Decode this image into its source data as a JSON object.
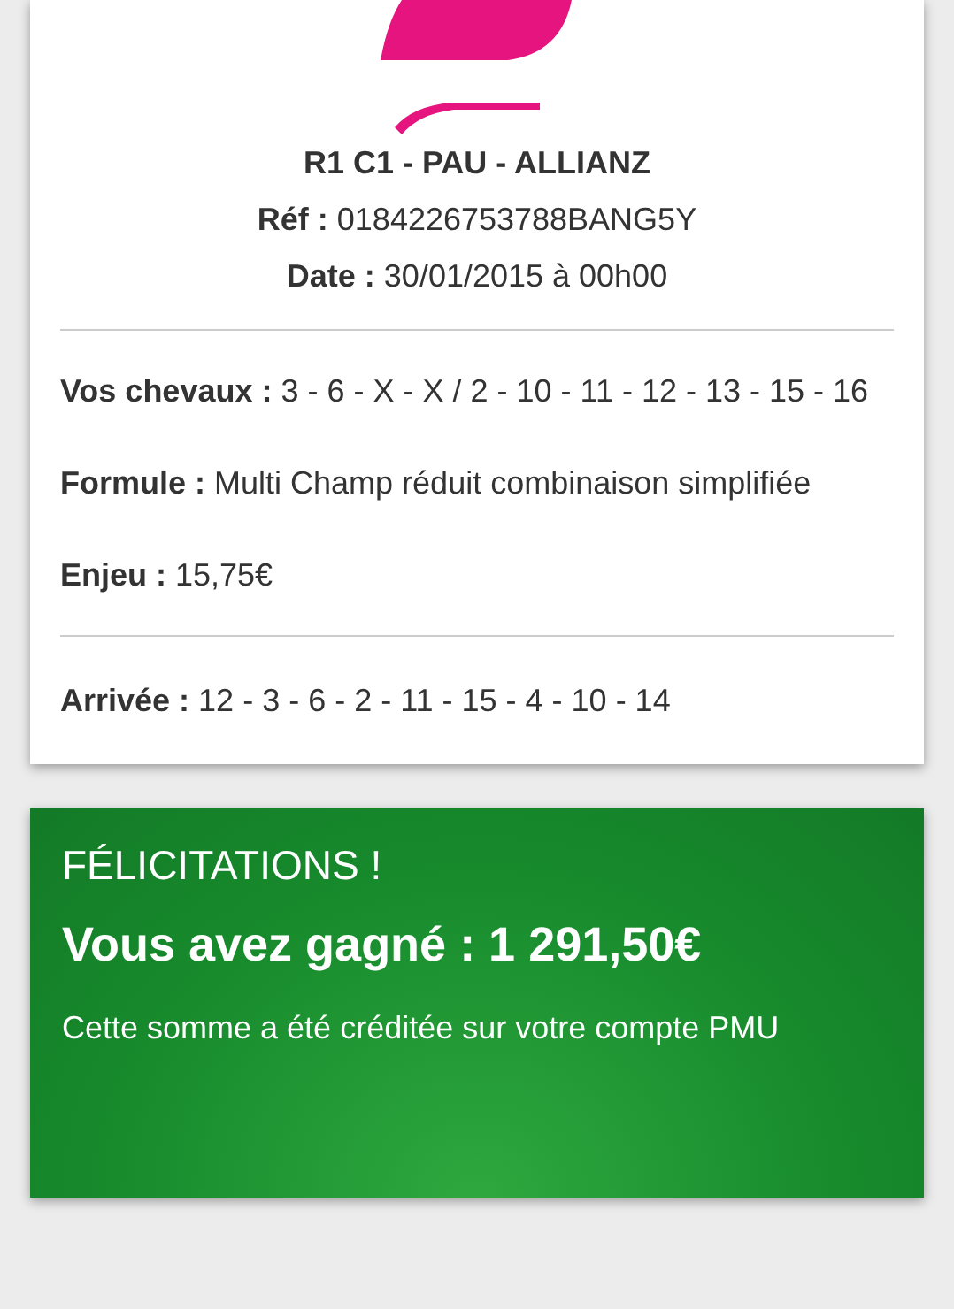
{
  "ticket": {
    "title": "R1 C1 - PAU - ALLIANZ",
    "ref": "**Réf :** 0184226753788BANG5Y",
    "date": "**Date :** 30/01/2015 à 00h00",
    "details": [
      "**Vos chevaux :** 3 - 6 - X - X / 2 - 10 - 11 - 12 - 13 - 15 - 16",
      "**Formule :** Multi Champ réduit combinaison simplifiée",
      "**Enjeu :** 15,75€"
    ],
    "arrival": "**Arrivée :** 12 - 3 - 6 - 2 - 11 - 15 - 4 - 10 - 14"
  },
  "win": {
    "title": "FÉLICITATIONS !",
    "amount": "Vous avez gagné : 1 291,50€",
    "message": "Cette somme a été créditée sur votre compte PMU"
  }
}
